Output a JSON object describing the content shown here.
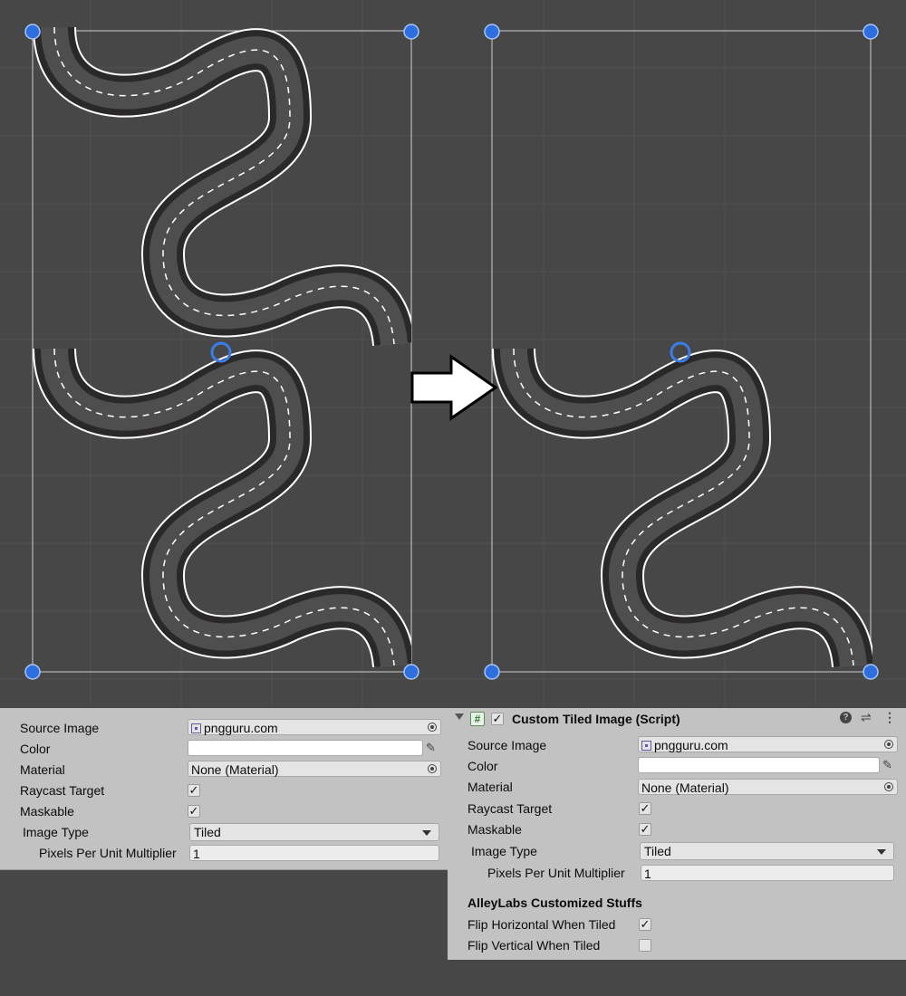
{
  "colors": {
    "scene_bg": "#474747",
    "grid": "#525252",
    "road_dark": "#1c1a1a",
    "road_light": "#8a8a8a",
    "road_edge": "#ffffff",
    "handle": "#2e6fe0",
    "panel_bg": "#c2c2c2"
  },
  "left_inspector": {
    "source_image_label": "Source Image",
    "source_image_value": "pngguru.com",
    "color_label": "Color",
    "material_label": "Material",
    "material_value": "None (Material)",
    "raycast_label": "Raycast Target",
    "raycast_checked": "✓",
    "maskable_label": "Maskable",
    "maskable_checked": "✓",
    "image_type_label": "Image Type",
    "image_type_value": "Tiled",
    "ppu_label": "Pixels Per Unit Multiplier",
    "ppu_value": "1"
  },
  "right_inspector": {
    "component_title": "Custom Tiled Image (Script)",
    "enabled_check": "✓",
    "script_icon": "#",
    "source_image_label": "Source Image",
    "source_image_value": "pngguru.com",
    "color_label": "Color",
    "material_label": "Material",
    "material_value": "None (Material)",
    "raycast_label": "Raycast Target",
    "raycast_checked": "✓",
    "maskable_label": "Maskable",
    "maskable_checked": "✓",
    "image_type_label": "Image Type",
    "image_type_value": "Tiled",
    "ppu_label": "Pixels Per Unit Multiplier",
    "ppu_value": "1",
    "section_title": "AlleyLabs Customized Stuffs",
    "flip_h_label": "Flip Horizontal When Tiled",
    "flip_h_checked": "✓",
    "flip_v_label": "Flip Vertical When Tiled",
    "flip_v_checked": ""
  },
  "icons": {
    "help": "help-icon",
    "settings": "preset-sliders-icon",
    "menu": "kebab-menu-icon",
    "fold": "foldout-arrow-icon",
    "eyedropper": "eyedropper-icon",
    "object_picker": "object-picker-icon",
    "sprite": "sprite-icon",
    "arrow": "right-arrow-icon"
  }
}
